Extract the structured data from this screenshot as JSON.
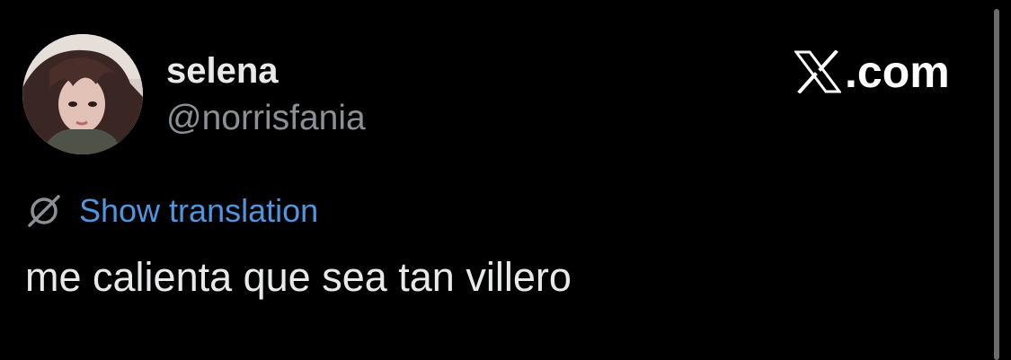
{
  "post": {
    "author": {
      "display_name": "selena",
      "handle": "@norrisfania"
    },
    "brand": {
      "label": ".com",
      "icon": "x-logo-icon"
    },
    "translation": {
      "icon": "globe-slash-icon",
      "label": "Show translation"
    },
    "text": "me calienta que sea tan villero"
  },
  "colors": {
    "background": "#000000",
    "primary_text": "#e7e9ea",
    "secondary_text": "#8b9096",
    "link": "#4f95e0"
  }
}
